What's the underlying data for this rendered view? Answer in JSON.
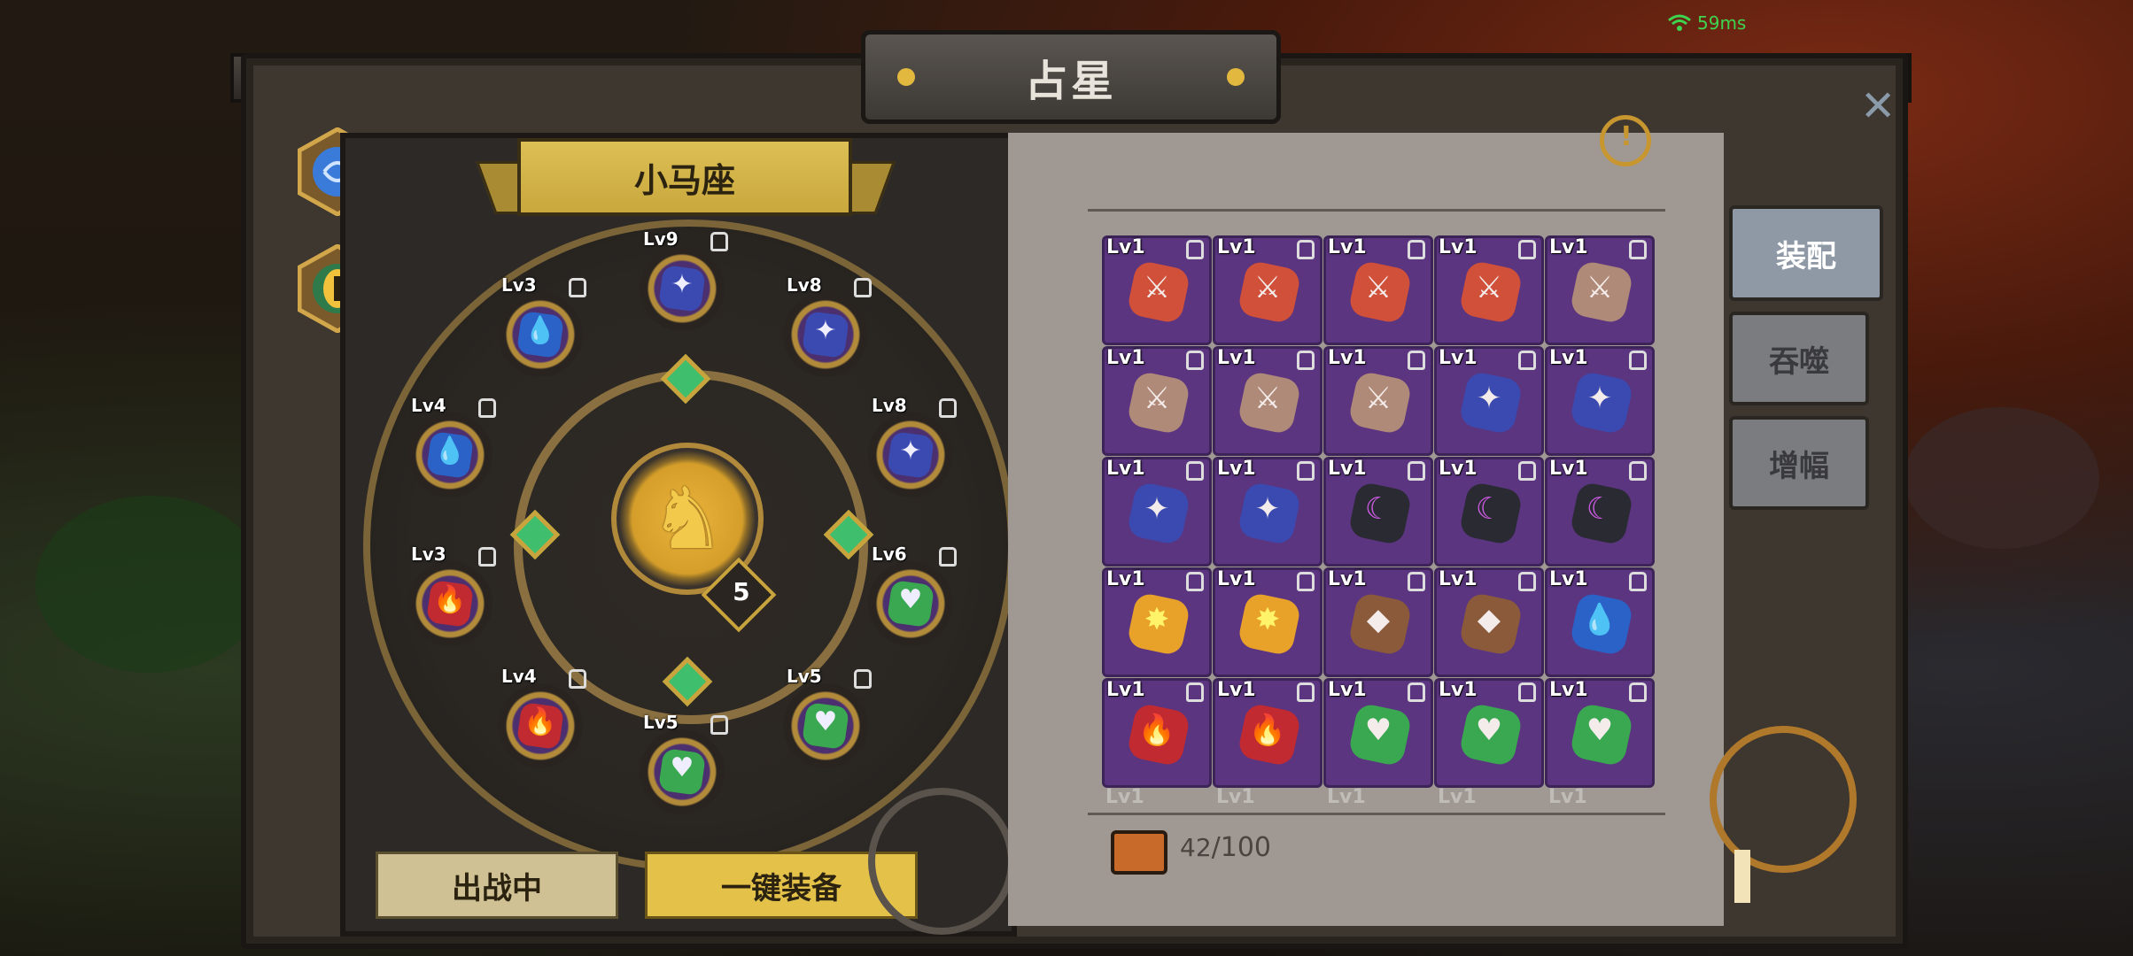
{
  "window": {
    "title": "占星"
  },
  "status": {
    "ping": "59ms"
  },
  "constellation": {
    "name": "小马座",
    "level": "5",
    "emblem_icon": "horse-icon"
  },
  "slots": [
    {
      "lv": "Lv9",
      "icon": "sword-orb",
      "color": "#3a4ab0",
      "glyph": "✦"
    },
    {
      "lv": "Lv3",
      "icon": "water-drop",
      "color": "#2a62c8",
      "glyph": "💧"
    },
    {
      "lv": "Lv8",
      "icon": "sword-orb",
      "color": "#3a4ab0",
      "glyph": "✦"
    },
    {
      "lv": "Lv4",
      "icon": "water-drop",
      "color": "#2a62c8",
      "glyph": "💧"
    },
    {
      "lv": "Lv8",
      "icon": "sword-orb",
      "color": "#3a4ab0",
      "glyph": "✦"
    },
    {
      "lv": "Lv3",
      "icon": "flame",
      "color": "#c02a30",
      "glyph": "🔥"
    },
    {
      "lv": "Lv6",
      "icon": "heart-leaf",
      "color": "#3aa850",
      "glyph": "♥"
    },
    {
      "lv": "Lv4",
      "icon": "flame",
      "color": "#c02a30",
      "glyph": "🔥"
    },
    {
      "lv": "Lv5",
      "icon": "heart-leaf",
      "color": "#3aa850",
      "glyph": "♥"
    },
    {
      "lv": "Lv5",
      "icon": "heart-leaf",
      "color": "#3aa850",
      "glyph": "♥"
    }
  ],
  "buttons": {
    "active": "出战中",
    "one_click_equip": "一键装备"
  },
  "tabs": {
    "equip": "装配",
    "devour": "吞噬",
    "amplify": "增幅"
  },
  "inventory": {
    "count": "42",
    "max": "/100",
    "rows": [
      [
        {
          "lv": "Lv1",
          "icon": "sword",
          "color": "#d0503a",
          "glyph": "⚔"
        },
        {
          "lv": "Lv1",
          "icon": "sword",
          "color": "#d0503a",
          "glyph": "⚔"
        },
        {
          "lv": "Lv1",
          "icon": "sword",
          "color": "#d0503a",
          "glyph": "⚔"
        },
        {
          "lv": "Lv1",
          "icon": "sword",
          "color": "#d0503a",
          "glyph": "⚔"
        },
        {
          "lv": "Lv1",
          "icon": "sword",
          "color": "#b08a78",
          "glyph": "⚔"
        }
      ],
      [
        {
          "lv": "Lv1",
          "icon": "sword",
          "color": "#b08a78",
          "glyph": "⚔"
        },
        {
          "lv": "Lv1",
          "icon": "sword",
          "color": "#b08a78",
          "glyph": "⚔"
        },
        {
          "lv": "Lv1",
          "icon": "sword",
          "color": "#b08a78",
          "glyph": "⚔"
        },
        {
          "lv": "Lv1",
          "icon": "sword-orb",
          "color": "#3a4ab0",
          "glyph": "✦"
        },
        {
          "lv": "Lv1",
          "icon": "sword-orb",
          "color": "#3a4ab0",
          "glyph": "✦"
        }
      ],
      [
        {
          "lv": "Lv1",
          "icon": "sword-orb",
          "color": "#3a4ab0",
          "glyph": "✦"
        },
        {
          "lv": "Lv1",
          "icon": "sword-orb",
          "color": "#3a4ab0",
          "glyph": "✦"
        },
        {
          "lv": "Lv1",
          "icon": "moon",
          "color": "#2a2a33",
          "glyph": "☾"
        },
        {
          "lv": "Lv1",
          "icon": "moon",
          "color": "#2a2a33",
          "glyph": "☾"
        },
        {
          "lv": "Lv1",
          "icon": "moon",
          "color": "#2a2a33",
          "glyph": "☾"
        }
      ],
      [
        {
          "lv": "Lv1",
          "icon": "sun",
          "color": "#e8a22a",
          "glyph": "✸"
        },
        {
          "lv": "Lv1",
          "icon": "sun",
          "color": "#e8a22a",
          "glyph": "✸"
        },
        {
          "lv": "Lv1",
          "icon": "shield",
          "color": "#8a5a3a",
          "glyph": "◆"
        },
        {
          "lv": "Lv1",
          "icon": "shield",
          "color": "#8a5a3a",
          "glyph": "◆"
        },
        {
          "lv": "Lv1",
          "icon": "water-drop",
          "color": "#2a62c8",
          "glyph": "💧"
        }
      ],
      [
        {
          "lv": "Lv1",
          "icon": "flame",
          "color": "#c02a30",
          "glyph": "🔥"
        },
        {
          "lv": "Lv1",
          "icon": "flame",
          "color": "#c02a30",
          "glyph": "🔥"
        },
        {
          "lv": "Lv1",
          "icon": "heart-leaf",
          "color": "#3aa850",
          "glyph": "♥"
        },
        {
          "lv": "Lv1",
          "icon": "heart-leaf",
          "color": "#3aa850",
          "glyph": "♥"
        },
        {
          "lv": "Lv1",
          "icon": "heart-leaf",
          "color": "#3aa850",
          "glyph": "♥"
        }
      ]
    ],
    "ghost_labels": [
      "Lv1",
      "Lv1",
      "Lv1",
      "Lv1",
      "Lv1"
    ]
  }
}
